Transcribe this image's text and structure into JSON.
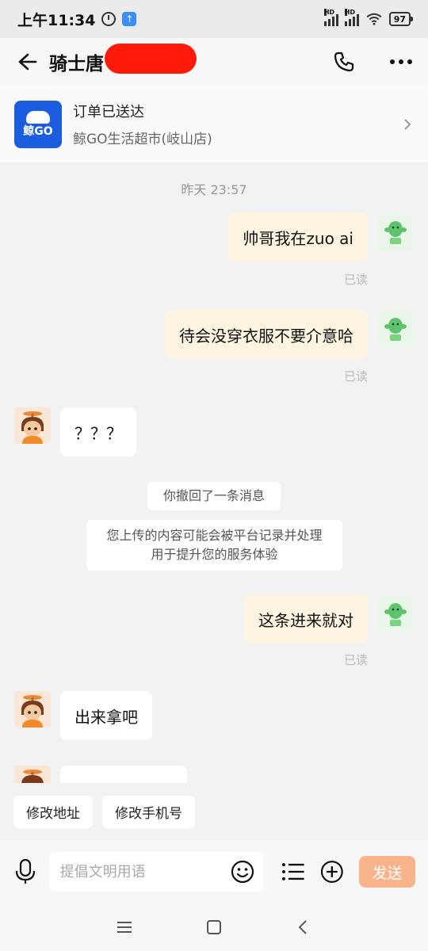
{
  "status_bar": {
    "time": "上午11:34",
    "battery": "97",
    "network_labels": [
      "HD",
      "HD"
    ]
  },
  "header": {
    "title": "骑士唐",
    "icons": [
      "back-icon",
      "phone-icon",
      "more-icon"
    ]
  },
  "order_card": {
    "status": "订单已送达",
    "store_name": "鲸GO生活超市(岐山店)",
    "logo_text": "鲸GO"
  },
  "chat": {
    "timestamp": "昨天 23:57",
    "messages": [
      {
        "side": "out",
        "text": "帅哥我在zuo ai",
        "read": "已读"
      },
      {
        "side": "out",
        "text": "待会没穿衣服不要介意哈",
        "read": "已读"
      },
      {
        "side": "in",
        "text": "？？？"
      },
      {
        "side": "notice",
        "text": "你撤回了一条消息"
      },
      {
        "side": "notice",
        "lines": [
          "您上传的内容可能会被平台记录并处理",
          "用于提升您的服务体验"
        ]
      },
      {
        "side": "out",
        "text": "这条进来就对",
        "read": "已读"
      },
      {
        "side": "in",
        "text": "出来拿吧"
      }
    ]
  },
  "quick_replies": [
    "修改地址",
    "修改手机号"
  ],
  "input": {
    "placeholder": "提倡文明用语",
    "send_label": "发送"
  },
  "colors": {
    "out_bubble": "#fdf5e2",
    "in_bubble": "#ffffff",
    "send_button": "#f9b48b",
    "logo_blue": "#1c5de0",
    "redaction": "#ff1a0a"
  }
}
